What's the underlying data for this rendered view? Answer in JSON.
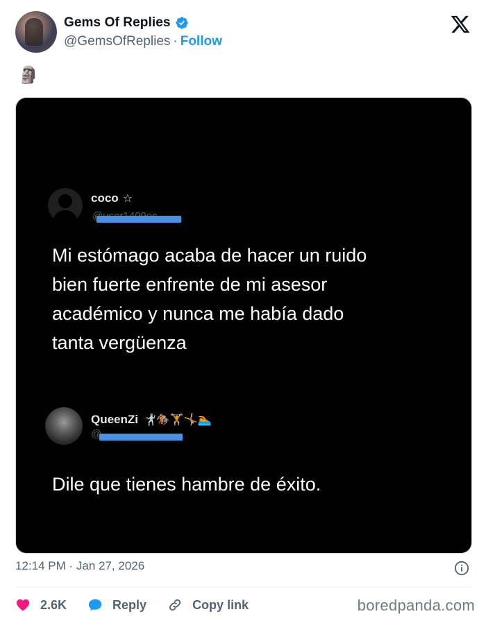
{
  "tweet": {
    "author_name": "Gems Of Replies",
    "author_handle": "@GemsOfReplies",
    "separator": "·",
    "follow_label": "Follow",
    "emoji": "🗿",
    "timestamp": "12:14 PM · Jan 27, 2026",
    "likes": "2.6K",
    "reply_label": "Reply",
    "copy_link_label": "Copy link"
  },
  "media": {
    "post1": {
      "username": "coco",
      "badge": "☆",
      "handle_visible": "@user1409ec",
      "text_lines": [
        "Mi estómago acaba de hacer un ruido",
        "bien fuerte enfrente de mi asesor",
        "académico y nunca me había dado",
        "tanta vergüenza"
      ]
    },
    "post2": {
      "username": "QueenZi",
      "emojis": "🤺🏇🏋🤸🏊",
      "handle_visible": "@",
      "text": "Dile que tienes hambre de éxito."
    }
  },
  "watermark": "boredpanda.com",
  "colors": {
    "accent": "#1d9bf0",
    "like": "#f91880",
    "text_secondary": "#536471",
    "media_bg": "#000000"
  },
  "icons": [
    "verified-badge-icon",
    "x-logo-icon",
    "info-icon",
    "heart-icon",
    "reply-bubble-icon",
    "link-icon"
  ]
}
